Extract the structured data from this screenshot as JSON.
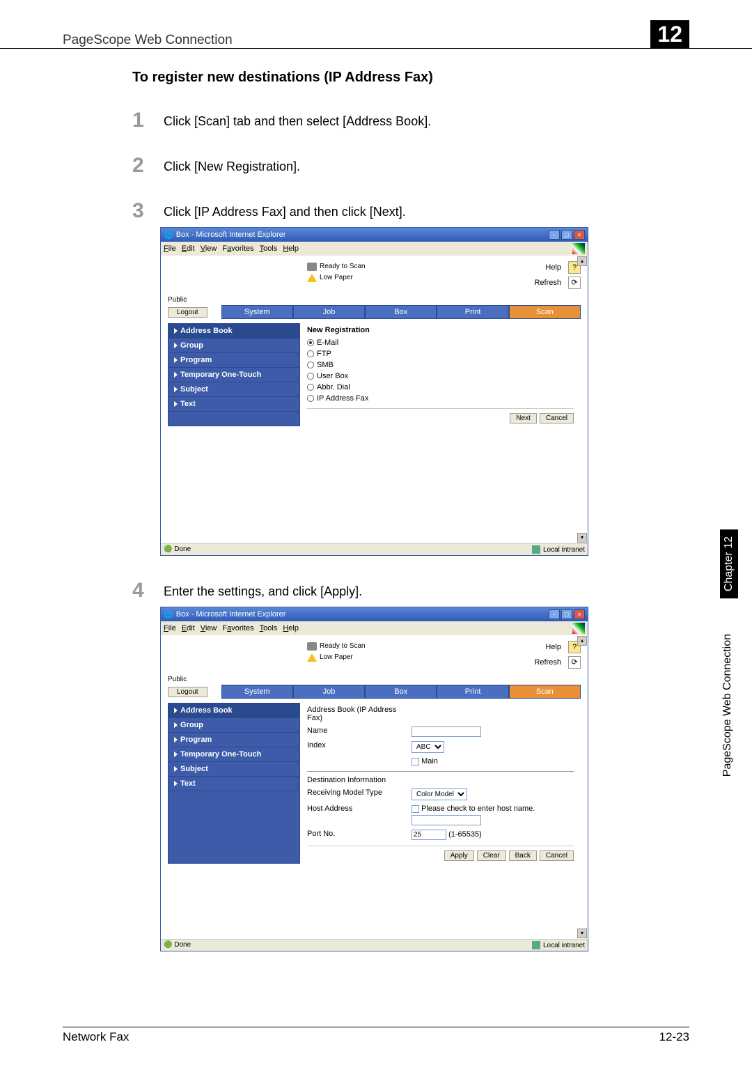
{
  "header": {
    "title": "PageScope Web Connection",
    "chapter": "12"
  },
  "section_title": "To register new destinations (IP Address Fax)",
  "steps": {
    "s1": "Click [Scan] tab and then select [Address Book].",
    "s2": "Click [New Registration].",
    "s3": "Click [IP Address Fax] and then click [Next].",
    "s4": "Enter the settings, and click [Apply]."
  },
  "browser": {
    "title": "Box - Microsoft Internet Explorer",
    "menu": {
      "file": "File",
      "edit": "Edit",
      "view": "View",
      "favorites": "Favorites",
      "tools": "Tools",
      "help": "Help"
    },
    "status": {
      "ready": "Ready to Scan",
      "lowpaper": "Low Paper"
    },
    "help": "Help",
    "refresh": "Refresh",
    "public": "Public",
    "logout": "Logout",
    "tabs": {
      "system": "System",
      "job": "Job",
      "box": "Box",
      "print": "Print",
      "scan": "Scan"
    },
    "sidebar": {
      "address_book": "Address Book",
      "group": "Group",
      "program": "Program",
      "temp": "Temporary One-Touch",
      "subject": "Subject",
      "text": "Text"
    },
    "statusbar": {
      "done": "Done",
      "zone": "Local intranet"
    }
  },
  "form1": {
    "title": "New Registration",
    "email": "E-Mail",
    "ftp": "FTP",
    "smb": "SMB",
    "userbox": "User Box",
    "abbr": "Abbr. Dial",
    "ipfax": "IP Address Fax",
    "next": "Next",
    "cancel": "Cancel"
  },
  "form2": {
    "title": "Address Book (IP Address Fax)",
    "name": "Name",
    "index": "Index",
    "index_value": "ABC",
    "main": "Main",
    "dest_info": "Destination Information",
    "recv_model": "Receiving Model Type",
    "recv_model_value": "Color Model",
    "host_addr": "Host Address",
    "host_check": "Please check to enter host name.",
    "port_no": "Port No.",
    "port_value": "25",
    "port_range": "(1-65535)",
    "apply": "Apply",
    "clear": "Clear",
    "back": "Back",
    "cancel": "Cancel"
  },
  "sidelabel": {
    "chapter": "Chapter 12",
    "title": "PageScope Web Connection"
  },
  "footer": {
    "left": "Network Fax",
    "right": "12-23"
  }
}
